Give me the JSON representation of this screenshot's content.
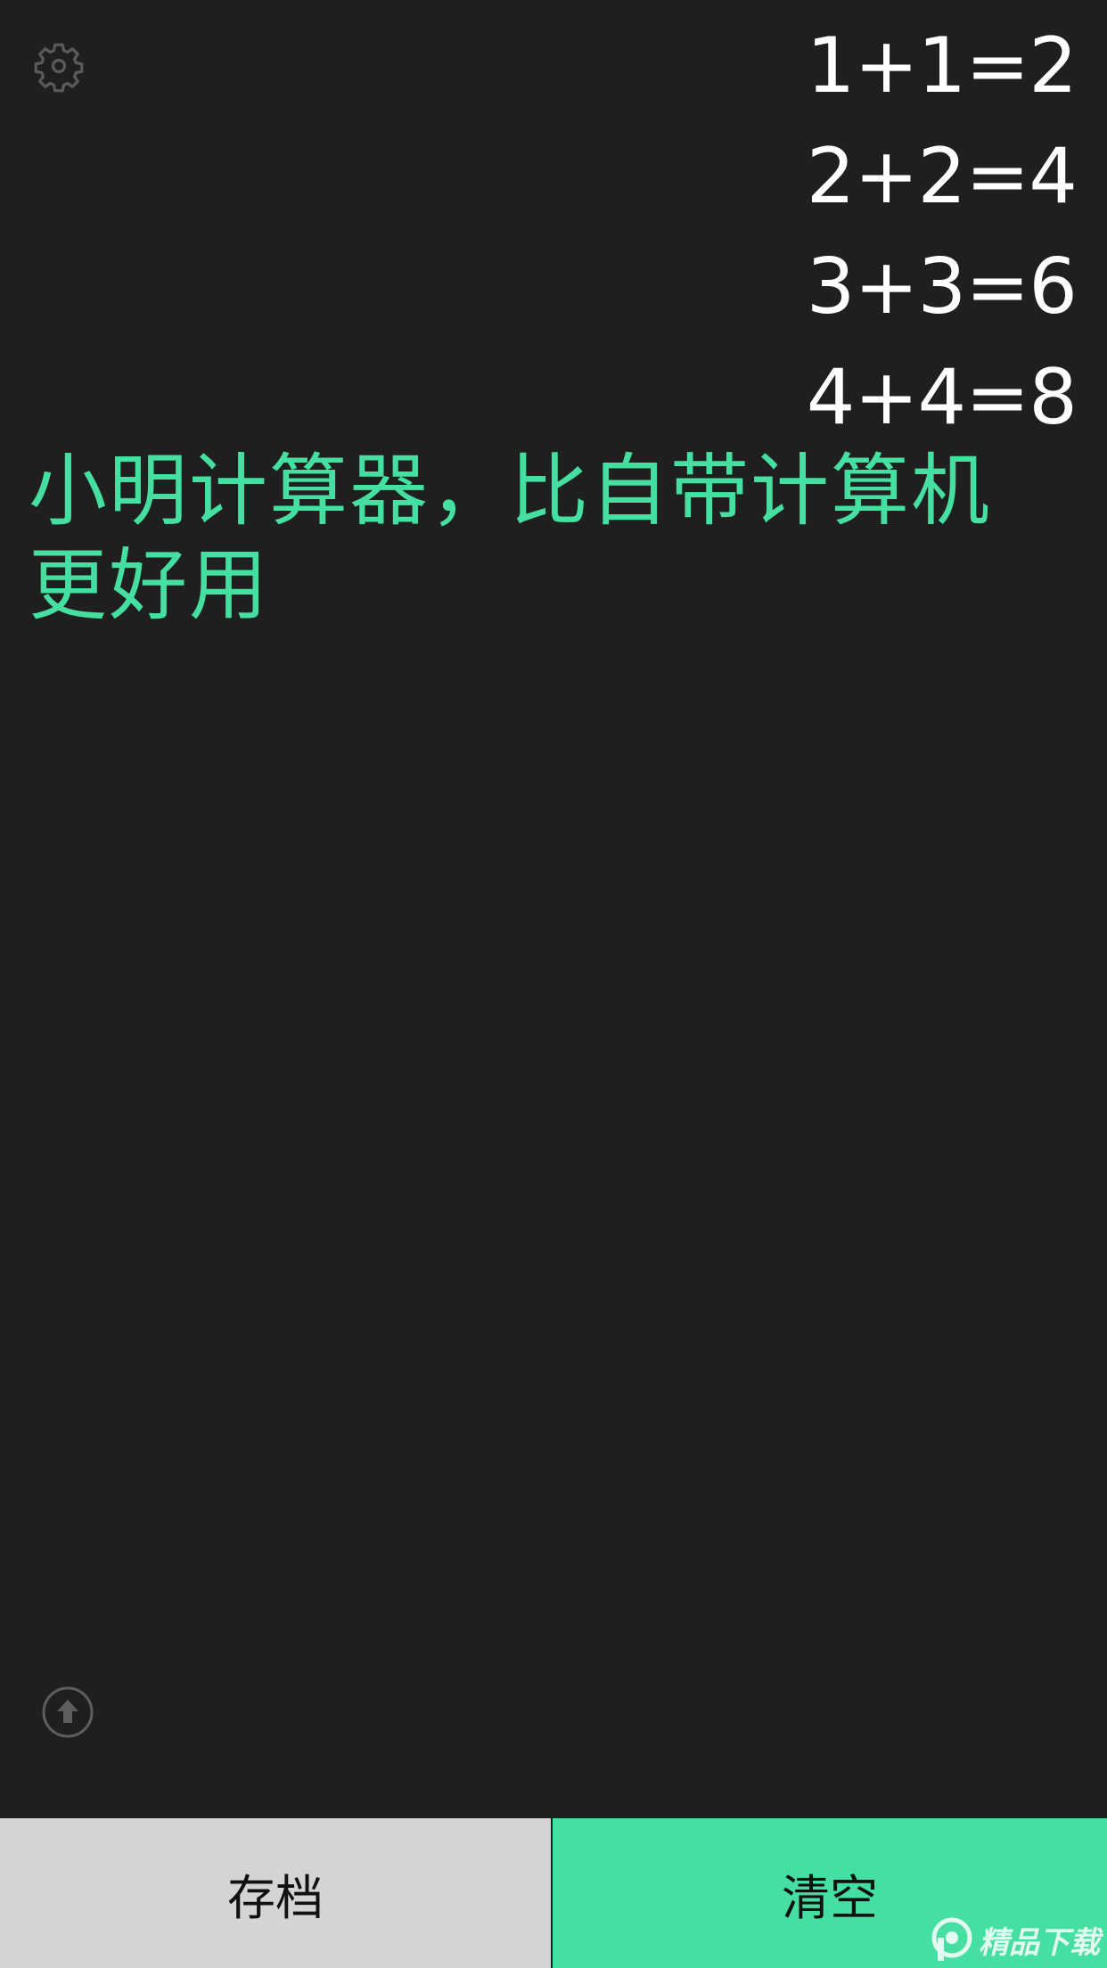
{
  "history": [
    "1+1=2",
    "2+2=4",
    "3+3=6",
    "4+4=8"
  ],
  "current_input": "小明计算器，比自带计算机更好用",
  "buttons": {
    "save_label": "存档",
    "clear_label": "清空"
  },
  "icons": {
    "settings": "gear-icon",
    "scroll_up": "arrow-up-circle-icon",
    "watermark": "watermark-logo-icon"
  },
  "watermark": {
    "text": "精品下载"
  },
  "colors": {
    "background": "#1f1f1f",
    "accent": "#44dfa1",
    "save_button": "#d4d4d4",
    "history_text": "#ffffff"
  }
}
